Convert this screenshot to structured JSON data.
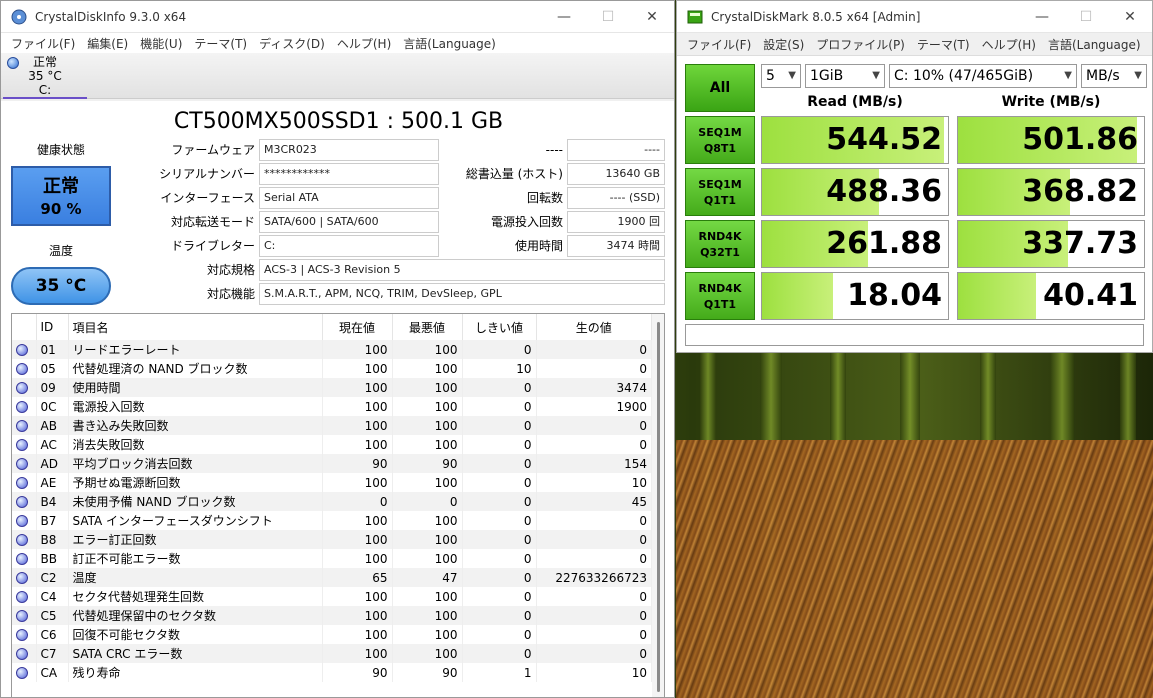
{
  "cdi": {
    "title": "CrystalDiskInfo 9.3.0 x64",
    "menu": [
      "ファイル(F)",
      "編集(E)",
      "機能(U)",
      "テーマ(T)",
      "ディスク(D)",
      "ヘルプ(H)",
      "言語(Language)"
    ],
    "disk_tab": {
      "status": "正常",
      "temp": "35 °C",
      "drive": "C:"
    },
    "model": "CT500MX500SSD1 : 500.1 GB",
    "health_label": "健康状態",
    "health_status": "正常",
    "health_percent": "90 %",
    "temp_label": "温度",
    "temp_value": "35 °C",
    "fields": {
      "firmware_label": "ファームウェア",
      "firmware": "M3CR023",
      "serial_label": "シリアルナンバー",
      "serial": "************",
      "interface_label": "インターフェース",
      "interface": "Serial ATA",
      "transfer_label": "対応転送モード",
      "transfer": "SATA/600 | SATA/600",
      "drive_label": "ドライブレター",
      "drive": "C:",
      "standard_label": "対応規格",
      "standard": "ACS-3 | ACS-3 Revision 5",
      "features_label": "対応機能",
      "features": "S.M.A.R.T., APM, NCQ, TRIM, DevSleep, GPL",
      "blank1": "----",
      "blank2": "----",
      "host_writes_label": "総書込量 (ホスト)",
      "host_writes": "13640 GB",
      "rotation_label": "回転数",
      "rotation": "---- (SSD)",
      "power_count_label": "電源投入回数",
      "power_count": "1900 回",
      "power_hours_label": "使用時間",
      "power_hours": "3474 時間"
    },
    "smart_headers": [
      "ID",
      "項目名",
      "現在値",
      "最悪値",
      "しきい値",
      "生の値"
    ],
    "smart_rows": [
      [
        "01",
        "リードエラーレート",
        "100",
        "100",
        "0",
        "0"
      ],
      [
        "05",
        "代替処理済の NAND ブロック数",
        "100",
        "100",
        "10",
        "0"
      ],
      [
        "09",
        "使用時間",
        "100",
        "100",
        "0",
        "3474"
      ],
      [
        "0C",
        "電源投入回数",
        "100",
        "100",
        "0",
        "1900"
      ],
      [
        "AB",
        "書き込み失敗回数",
        "100",
        "100",
        "0",
        "0"
      ],
      [
        "AC",
        "消去失敗回数",
        "100",
        "100",
        "0",
        "0"
      ],
      [
        "AD",
        "平均ブロック消去回数",
        "90",
        "90",
        "0",
        "154"
      ],
      [
        "AE",
        "予期せぬ電源断回数",
        "100",
        "100",
        "0",
        "10"
      ],
      [
        "B4",
        "未使用予備 NAND ブロック数",
        "0",
        "0",
        "0",
        "45"
      ],
      [
        "B7",
        "SATA インターフェースダウンシフト",
        "100",
        "100",
        "0",
        "0"
      ],
      [
        "B8",
        "エラー訂正回数",
        "100",
        "100",
        "0",
        "0"
      ],
      [
        "BB",
        "訂正不可能エラー数",
        "100",
        "100",
        "0",
        "0"
      ],
      [
        "C2",
        "温度",
        "65",
        "47",
        "0",
        "227633266723"
      ],
      [
        "C4",
        "セクタ代替処理発生回数",
        "100",
        "100",
        "0",
        "0"
      ],
      [
        "C5",
        "代替処理保留中のセクタ数",
        "100",
        "100",
        "0",
        "0"
      ],
      [
        "C6",
        "回復不可能セクタ数",
        "100",
        "100",
        "0",
        "0"
      ],
      [
        "C7",
        "SATA CRC エラー数",
        "100",
        "100",
        "0",
        "0"
      ],
      [
        "CA",
        "残り寿命",
        "90",
        "90",
        "1",
        "10"
      ]
    ]
  },
  "cdm": {
    "title": "CrystalDiskMark 8.0.5 x64 [Admin]",
    "menu": [
      "ファイル(F)",
      "設定(S)",
      "プロファイル(P)",
      "テーマ(T)",
      "ヘルプ(H)",
      "言語(Language)"
    ],
    "all_label": "All",
    "count": "5",
    "size": "1GiB",
    "drive": "C: 10% (47/465GiB)",
    "unit": "MB/s",
    "read_header": "Read (MB/s)",
    "write_header": "Write (MB/s)",
    "tests": [
      {
        "l1": "SEQ1M",
        "l2": "Q8T1",
        "read": "544.52",
        "write": "501.86",
        "read_fill": 0.98,
        "write_fill": 0.96
      },
      {
        "l1": "SEQ1M",
        "l2": "Q1T1",
        "read": "488.36",
        "write": "368.82",
        "read_fill": 0.63,
        "write_fill": 0.6
      },
      {
        "l1": "RND4K",
        "l2": "Q32T1",
        "read": "261.88",
        "write": "337.73",
        "read_fill": 0.57,
        "write_fill": 0.59
      },
      {
        "l1": "RND4K",
        "l2": "Q1T1",
        "read": "18.04",
        "write": "40.41",
        "read_fill": 0.38,
        "write_fill": 0.42
      }
    ]
  }
}
